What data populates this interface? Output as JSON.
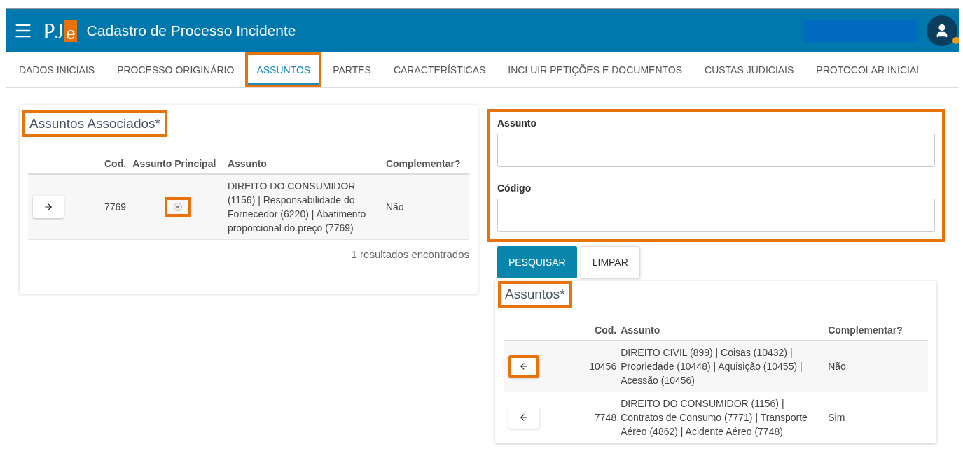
{
  "header": {
    "title": "Cadastro de Processo Incidente",
    "logo": {
      "text": "PJ",
      "accent": "e"
    }
  },
  "tabs": [
    {
      "label": "DADOS INICIAIS",
      "selected": false,
      "highlighted": false
    },
    {
      "label": "PROCESSO ORIGINÁRIO",
      "selected": false,
      "highlighted": false
    },
    {
      "label": "ASSUNTOS",
      "selected": true,
      "highlighted": true
    },
    {
      "label": "PARTES",
      "selected": false,
      "highlighted": false
    },
    {
      "label": "CARACTERÍSTICAS",
      "selected": false,
      "highlighted": false
    },
    {
      "label": "INCLUIR PETIÇÕES E DOCUMENTOS",
      "selected": false,
      "highlighted": false
    },
    {
      "label": "CUSTAS JUDICIAIS",
      "selected": false,
      "highlighted": false
    },
    {
      "label": "PROTOCOLAR INICIAL",
      "selected": false,
      "highlighted": false
    }
  ],
  "associated": {
    "title": "Assuntos Associados*",
    "highlighted": true,
    "columns": [
      "Cod.",
      "Assunto Principal",
      "Assunto",
      "Complementar?"
    ],
    "rows": [
      {
        "code": "7769",
        "principal": {
          "selected": true,
          "highlighted": true
        },
        "subject": "DIREITO DO CONSUMIDOR (1156) | Responsabilidade do Fornecedor (6220) | Abatimento proporcional do preço (7769)",
        "complement": "Não"
      }
    ],
    "footer": "1 resultados encontrados"
  },
  "search": {
    "highlighted": true,
    "fields": [
      {
        "label": "Assunto"
      },
      {
        "label": "Código"
      }
    ],
    "buttons": [
      {
        "label": "PESQUISAR",
        "kind": "primary"
      },
      {
        "label": "LIMPAR",
        "kind": "secondary"
      }
    ]
  },
  "subjects": {
    "title": "Assuntos*",
    "highlighted": true,
    "columns": [
      "Cod.",
      "Assunto",
      "Complementar?"
    ],
    "rows": [
      {
        "code": "10456",
        "subject": "DIREITO CIVIL (899) | Coisas (10432) | Propriedade (10448) | Aquisição (10455) | Acessão (10456)",
        "complement": "Não",
        "highlighted": true
      },
      {
        "code": "7748",
        "subject": "DIREITO DO CONSUMIDOR (1156) | Contratos de Consumo (7771) | Transporte Aéreo (4862) | Acidente Aéreo (7748)",
        "complement": "Sim",
        "highlighted": false
      }
    ]
  }
}
